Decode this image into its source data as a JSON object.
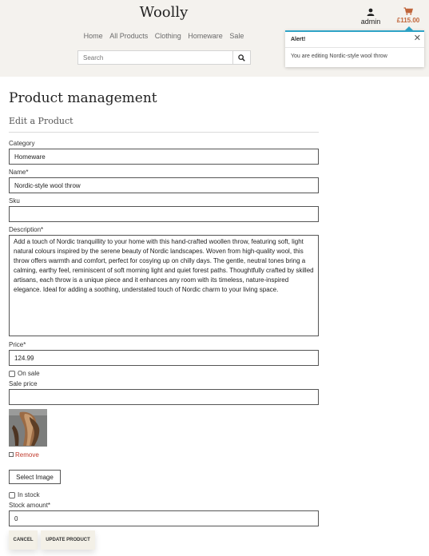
{
  "header": {
    "logo": "Woolly",
    "nav": [
      "Home",
      "All Products",
      "Clothing",
      "Homeware",
      "Sale"
    ],
    "search_placeholder": "Search",
    "account_label": "admin",
    "bag_total": "£115.00"
  },
  "toast": {
    "title": "Alert!",
    "message": "You are editing Nordic-style wool throw",
    "accent_color": "#2fa4c7"
  },
  "page": {
    "title": "Product management",
    "subtitle": "Edit a Product"
  },
  "form": {
    "category": {
      "label": "Category",
      "value": "Homeware"
    },
    "name": {
      "label": "Name*",
      "value": "Nordic-style wool throw"
    },
    "sku": {
      "label": "Sku",
      "value": ""
    },
    "description": {
      "label": "Description*",
      "value": "Add a touch of Nordic tranquillity to your home with this hand-crafted woollen throw, featuring soft, light natural colours inspired by the serene beauty of Nordic landscapes. Woven from high-quality wool, this throw offers warmth and comfort, perfect for cosying up on chilly days. The gentle, neutral tones bring a calming, earthy feel, reminiscent of soft morning light and quiet forest paths. Thoughtfully crafted by skilled artisans, each throw is a unique piece and it enhances any room with its timeless, nature-inspired elegance. Ideal for adding a soothing, understated touch of Nordic charm to your living space."
    },
    "price": {
      "label": "Price*",
      "value": "124.99"
    },
    "on_sale": {
      "label": "On sale",
      "checked": false
    },
    "sale_price": {
      "label": "Sale price",
      "value": ""
    },
    "remove_label": "Remove",
    "select_image_label": "Select Image",
    "in_stock": {
      "label": "In stock",
      "checked": false
    },
    "stock_amount": {
      "label": "Stock amount*",
      "value": "0"
    },
    "cancel_label": "CANCEL",
    "update_label": "UPDATE PRODUCT"
  },
  "colors": {
    "brand_accent": "#c0653a",
    "remove": "#c0392b",
    "header_bg": "#f4f2ee"
  }
}
